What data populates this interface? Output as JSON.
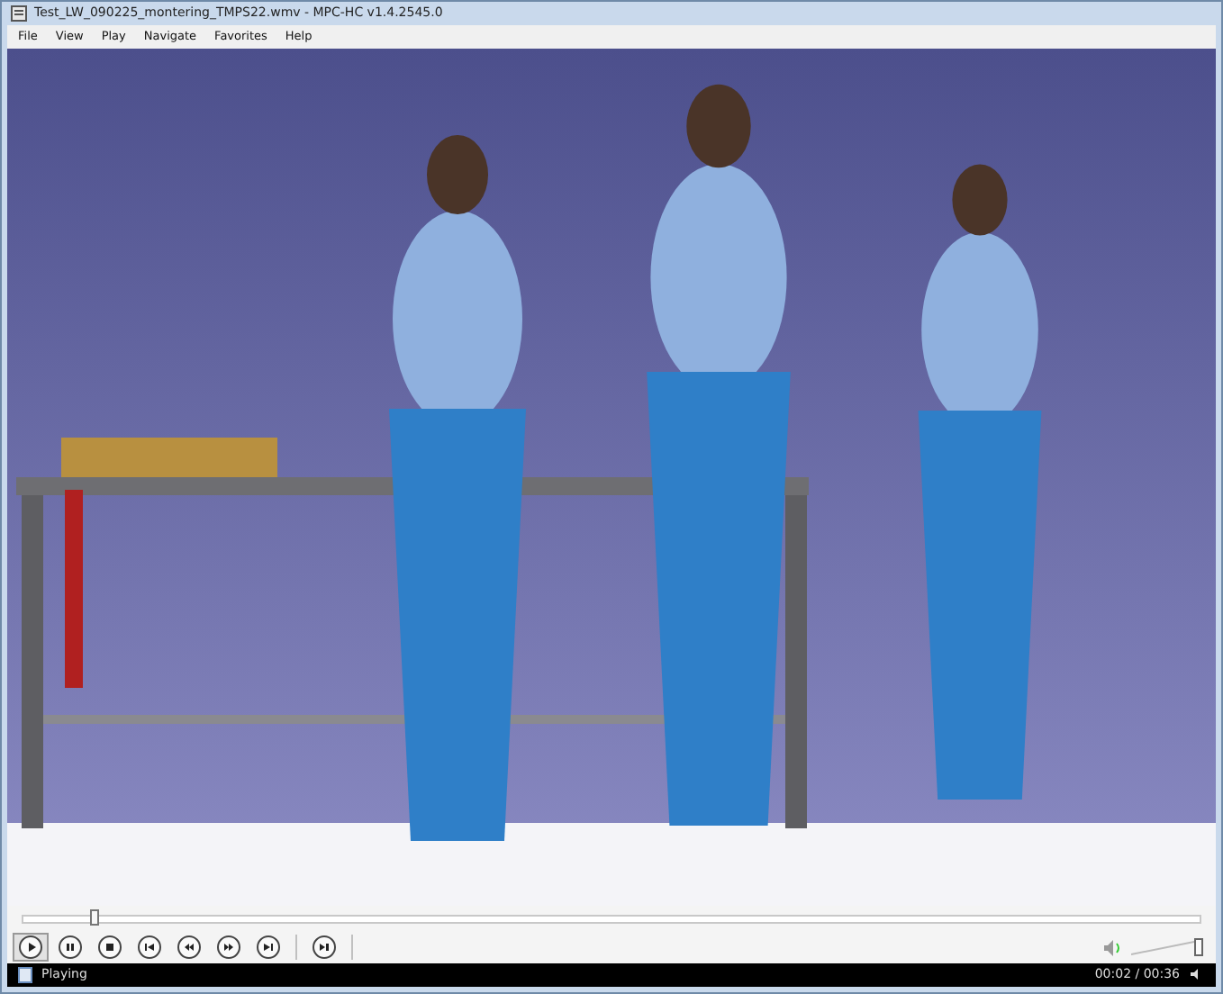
{
  "window": {
    "title": "Test_LW_090225_montering_TMPS22.wmv - MPC-HC v1.4.2545.0"
  },
  "menu": [
    "File",
    "View",
    "Play",
    "Navigate",
    "Favorites",
    "Help"
  ],
  "seek": {
    "level": 0.06
  },
  "controls": [
    {
      "kind": "play",
      "pressed": true
    },
    {
      "kind": "pause",
      "pressed": false
    },
    {
      "kind": "stop",
      "pressed": false
    },
    {
      "kind": "previous",
      "pressed": false
    },
    {
      "kind": "rewind",
      "pressed": false
    },
    {
      "kind": "forward",
      "pressed": false
    },
    {
      "kind": "next",
      "pressed": false
    },
    {
      "kind": "step",
      "pressed": false
    }
  ],
  "volume": {
    "level": 1.0
  },
  "status_bar": {
    "state": "Playing",
    "time": "00:02 / 00:36"
  }
}
